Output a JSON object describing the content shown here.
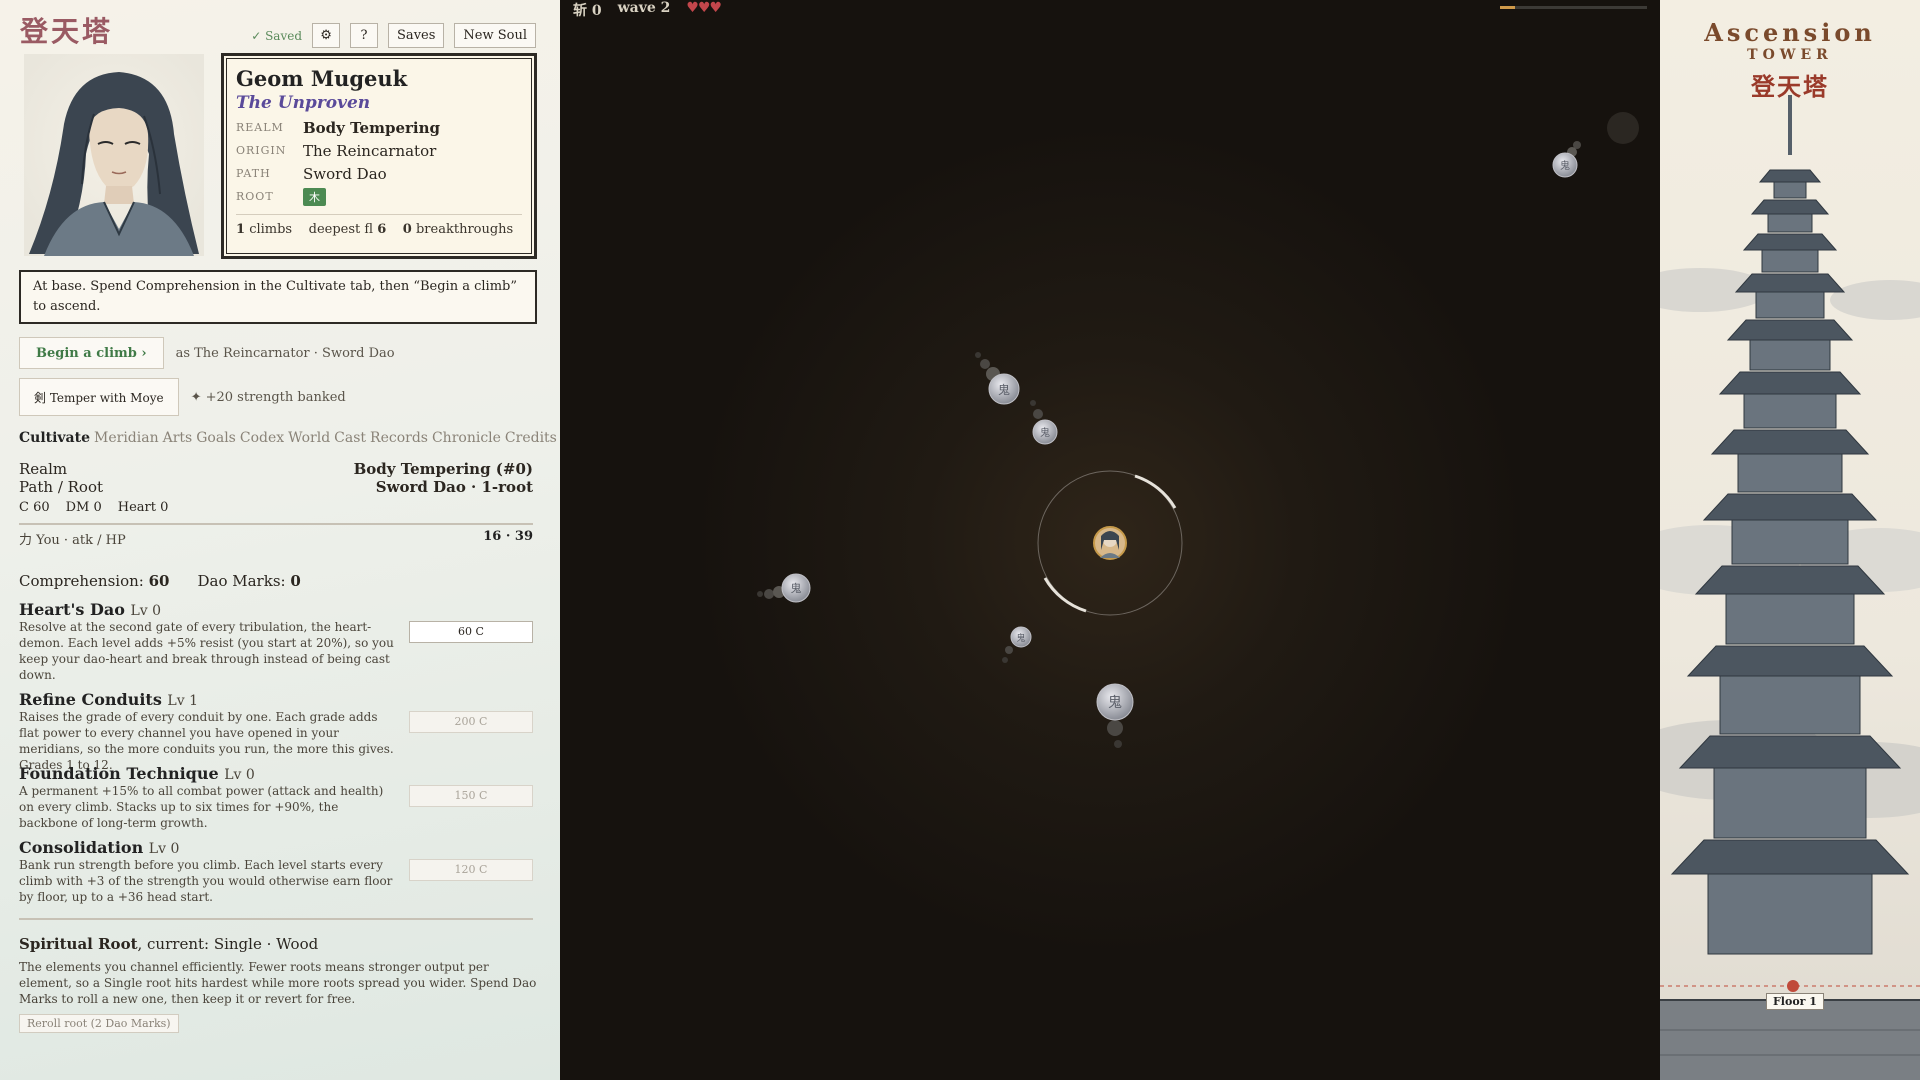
{
  "app": {
    "logo": "登天塔",
    "saved_text": "✓ Saved",
    "settings_icon": "gear-icon",
    "settings_label": "⚙",
    "help_label": "?",
    "saves_label": "Saves",
    "new_soul_label": "New Soul"
  },
  "character": {
    "name": "Geom Mugeuk",
    "epithet": "The Unproven",
    "realm_label": "REALM",
    "realm": "Body Tempering",
    "origin_label": "ORIGIN",
    "origin": "The Reincarnator",
    "path_label": "PATH",
    "path": "Sword Dao",
    "root_label": "ROOT",
    "root": "木",
    "climbs": "1",
    "climbs_label": "climbs",
    "deepest_label": "deepest fl",
    "deepest": "6",
    "breakthroughs": "0",
    "breakthroughs_label": "breakthroughs"
  },
  "status_text": "At base. Spend Comprehension in the Cultivate tab, then “Begin a climb” to ascend.",
  "actions": {
    "climb_label": "Begin a climb ›",
    "climb_note": "as The Reincarnator · Sword Dao",
    "temper_label": "剣 Temper with Moye",
    "temper_note": "✦ +20 strength banked"
  },
  "tabs": [
    "Cultivate",
    "Meridian",
    "Arts",
    "Goals",
    "Codex",
    "World",
    "Cast",
    "Records",
    "Chronicle",
    "Credits"
  ],
  "stats": {
    "realm_label": "Realm",
    "realm_value": "Body Tempering (#0)",
    "pathroot_label": "Path / Root",
    "pathroot_value": "Sword Dao · 1-root",
    "c": "C 60",
    "dm": "DM 0",
    "heart": "Heart 0",
    "atk_label": "力 You · atk / HP",
    "atk_value": "16 · 39"
  },
  "currency": {
    "comprehension_label": "Comprehension:",
    "comprehension": "60",
    "dao_label": "Dao Marks:",
    "dao": "0"
  },
  "upgrades": [
    {
      "name": "Heart's Dao",
      "level": "Lv 0",
      "desc": "Resolve at the second gate of every tribulation, the heart-demon. Each level adds +5% resist (you start at 20%), so you keep your dao-heart and break through instead of being cast down.",
      "cost": "60 C"
    },
    {
      "name": "Refine Conduits",
      "level": "Lv 1",
      "desc": "Raises the grade of every conduit by one. Each grade adds flat power to every channel you have opened in your meridians, so the more conduits you run, the more this gives. Grades 1 to 12.",
      "cost": "200 C"
    },
    {
      "name": "Foundation Technique",
      "level": "Lv 0",
      "desc": "A permanent +15% to all combat power (attack and health) on every climb. Stacks up to six times for +90%, the backbone of long-term growth.",
      "cost": "150 C"
    },
    {
      "name": "Consolidation",
      "level": "Lv 0",
      "desc": "Bank run strength before you climb. Each level starts every climb with +3 of the strength you would otherwise earn floor by floor, up to a +36 head start.",
      "cost": "120 C"
    }
  ],
  "spiritual_root": {
    "title": "Spiritual Root",
    "current": ", current: Single · Wood",
    "desc": "The elements you channel efficiently. Fewer roots means stronger output per element, so a Single root hits hardest while more roots spread you wider. Spend Dao Marks to roll a new one, then keep it or revert for free.",
    "reroll_label": "Reroll root (2 Dao Marks)"
  },
  "hud": {
    "kills": "斩 0",
    "wave": "wave 2",
    "hearts": "♥♥♥",
    "progress": 0.1
  },
  "tower": {
    "title": "Ascension",
    "subtitle": "TOWER",
    "chinese": "登天塔",
    "floor": "Floor 1"
  },
  "colors": {
    "accent_green": "#4c8a52",
    "heart_red": "#c2464b",
    "progress_gold": "#d09a4a"
  }
}
